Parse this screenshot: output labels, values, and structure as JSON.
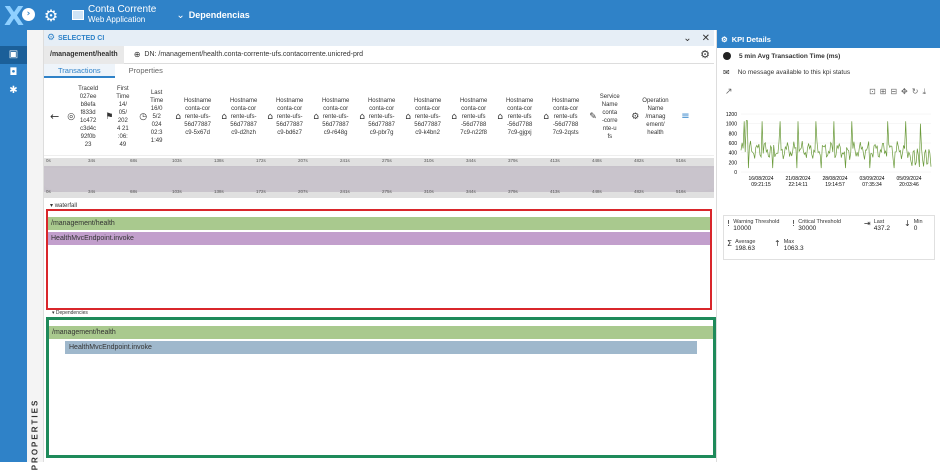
{
  "topbar": {
    "ci_title": "Conta Corrente",
    "ci_subtitle": "Web Application",
    "dependencies_label": "Dependencias"
  },
  "selected": {
    "label": "SELECTED CI",
    "path": "/management/health",
    "dn": "DN: /management/health.conta-corrente-ufs.contacorrente.unicred-prd"
  },
  "tabs": [
    {
      "label": "Transactions",
      "active": true
    },
    {
      "label": "Properties",
      "active": false
    }
  ],
  "header_cols": [
    {
      "icon": "fingerprint-icon",
      "text": "TraceId\n027ee\nb8efa\nf833d\n1c472\nc3d4c\n92f0b\n23"
    },
    {
      "icon": "flag-icon",
      "text": "First\nTime\n14/\n05/\n202\n4 21\n:06:\n49"
    },
    {
      "icon": "clock-icon",
      "text": "Last\nTime\n16/0\n5/2\n024\n02:3\n1:49"
    },
    {
      "icon": "home-icon",
      "text": "Hostname\nconta-cor\nrente-ufs-\n56d77887\nc9-5x67d"
    },
    {
      "icon": "home-icon",
      "text": "Hostname\nconta-cor\nrente-ufs-\n56d77887\nc9-d2hzh"
    },
    {
      "icon": "home-icon",
      "text": "Hostname\nconta-cor\nrente-ufs-\n56d77887\nc9-bd6z7"
    },
    {
      "icon": "home-icon",
      "text": "Hostname\nconta-cor\nrente-ufs-\n56d77887\nc9-r648g"
    },
    {
      "icon": "home-icon",
      "text": "Hostname\nconta-cor\nrente-ufs-\n56d77887\nc9-pbr7g"
    },
    {
      "icon": "home-icon",
      "text": "Hostname\nconta-cor\nrente-ufs-\n56d77887\nc9-k4bn2"
    },
    {
      "icon": "home-icon",
      "text": "Hostname\nconta-cor\nrente-ufs\n-56d7788\n7c9-n22f8"
    },
    {
      "icon": "home-icon",
      "text": "Hostname\nconta-cor\nrente-ufs\n-56d7788\n7c9-gjgxj"
    },
    {
      "icon": "home-icon",
      "text": "Hostname\nconta-cor\nrente-ufs\n-56d7788\n7c9-2qsts"
    },
    {
      "icon": "wrench-icon",
      "text": "Service\nName\nconta\n-corre\nnte-u\nfs"
    },
    {
      "icon": "gear-icon",
      "text": "Operation\nName\n/manag\nement/\nhealth"
    }
  ],
  "ticks": [
    "0s",
    "34s",
    "68s",
    "103s",
    "138s",
    "172s",
    "207s",
    "241s",
    "275s",
    "310s",
    "344s",
    "379s",
    "413s",
    "448s",
    "482s",
    "516s"
  ],
  "waterfall_label": "waterfall",
  "deps_label": "Dependencies",
  "spans": [
    {
      "label": "/management/health",
      "color": "#a9c98e"
    },
    {
      "label": "HealthMvcEndpoint.invoke",
      "color": "#c29fcc"
    }
  ],
  "spans_deps": [
    {
      "label": "/management/health",
      "color": "#a9c98e"
    },
    {
      "label": "HealthMvcEndpoint.invoke",
      "color": "#9fb8cc"
    }
  ],
  "properties_label": "PROPERTIES",
  "kpi": {
    "title": "KPI Details",
    "metric": "5 min Avg Transaction Time (ms)",
    "status": "No message available to this kpi status",
    "y_ticks": [
      "1200",
      "1000",
      "800",
      "600",
      "400",
      "200",
      "0"
    ],
    "x_labels": [
      "16/08/2024\n09:21:15",
      "21/08/2024\n22:14:11",
      "28/08/2024\n19:14:57",
      "03/09/2024\n07:35:34",
      "05/09/2024\n20:03:46"
    ],
    "warning_label": "Warning Threshold",
    "warning_value": "10000",
    "critical_label": "Critical Threshold",
    "critical_value": "30000",
    "last_label": "Last",
    "last_value": "437.2",
    "min_label": "Min",
    "min_value": "0",
    "average_label": "Average",
    "average_value": "198.63",
    "max_label": "Max",
    "max_value": "1063.3"
  }
}
